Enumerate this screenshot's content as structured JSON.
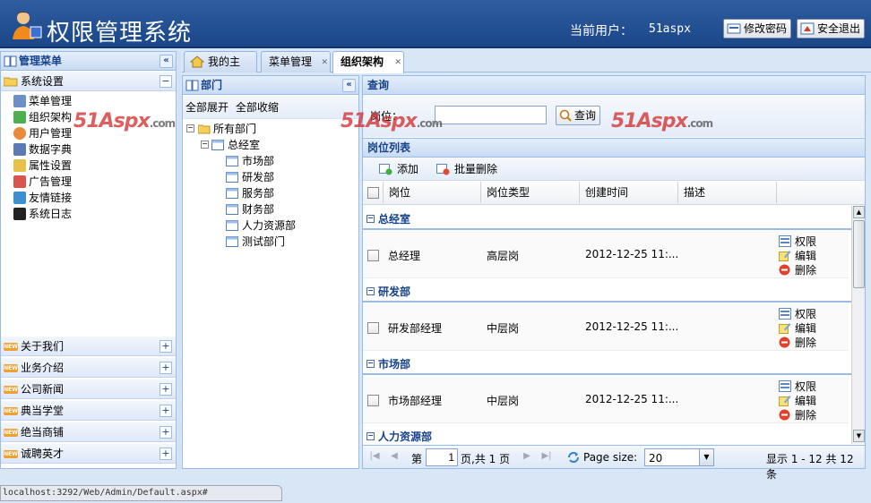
{
  "header": {
    "title": "权限管理系统",
    "user_label": "当前用户：",
    "user_name": "51aspx",
    "change_password": "修改密码",
    "logout": "安全退出"
  },
  "sidebar": {
    "title": "管理菜单",
    "collapse": "«",
    "section_title": "系统设置",
    "section_toggle": "−",
    "items": [
      {
        "label": "菜单管理"
      },
      {
        "label": "组织架构"
      },
      {
        "label": "用户管理"
      },
      {
        "label": "数据字典"
      },
      {
        "label": "属性设置"
      },
      {
        "label": "广告管理"
      },
      {
        "label": "友情链接"
      },
      {
        "label": "系统日志"
      }
    ],
    "sections": [
      {
        "label": "关于我们"
      },
      {
        "label": "业务介绍"
      },
      {
        "label": "公司新闻"
      },
      {
        "label": "典当学堂"
      },
      {
        "label": "绝当商铺"
      },
      {
        "label": "诚聘英才"
      }
    ],
    "badge": "NEW",
    "expand": "+"
  },
  "tabs": [
    {
      "label": "我的主页"
    },
    {
      "label": "菜单管理"
    },
    {
      "label": "组织架构"
    }
  ],
  "tab_close": "✕",
  "dept": {
    "title": "部门",
    "collapse": "«",
    "expand_all": "全部展开",
    "collapse_all": "全部收缩",
    "root": "所有部门",
    "node": "总经室",
    "children": [
      "市场部",
      "研发部",
      "服务部",
      "财务部",
      "人力资源部",
      "测试部门"
    ]
  },
  "query": {
    "title": "查询",
    "label": "岗位：",
    "value": "",
    "button": "查询"
  },
  "list": {
    "title": "岗位列表",
    "add": "添加",
    "batch_delete": "批量删除",
    "columns": [
      "岗位",
      "岗位类型",
      "创建时间",
      "描述"
    ],
    "groups": [
      {
        "name": "总经室",
        "row": {
          "position": "总经理",
          "type": "高层岗",
          "created": "2012-12-25 11:..."
        }
      },
      {
        "name": "研发部",
        "row": {
          "position": "研发部经理",
          "type": "中层岗",
          "created": "2012-12-25 11:..."
        }
      },
      {
        "name": "市场部",
        "row": {
          "position": "市场部经理",
          "type": "中层岗",
          "created": "2012-12-25 11:..."
        }
      },
      {
        "name": "人力资源部"
      }
    ],
    "actions": {
      "perm": "权限",
      "edit": "编辑",
      "delete": "删除"
    }
  },
  "pager": {
    "page_prefix": "第",
    "page": "1",
    "page_suffix": "页,共 1 页",
    "page_size_label": "Page size:",
    "page_size": "20",
    "summary": "显示 1 - 12 共 12 条"
  },
  "status_url": "localhost:3292/Web/Admin/Default.aspx#",
  "watermark": {
    "brand": "51Aspx",
    "domain": ".com"
  }
}
